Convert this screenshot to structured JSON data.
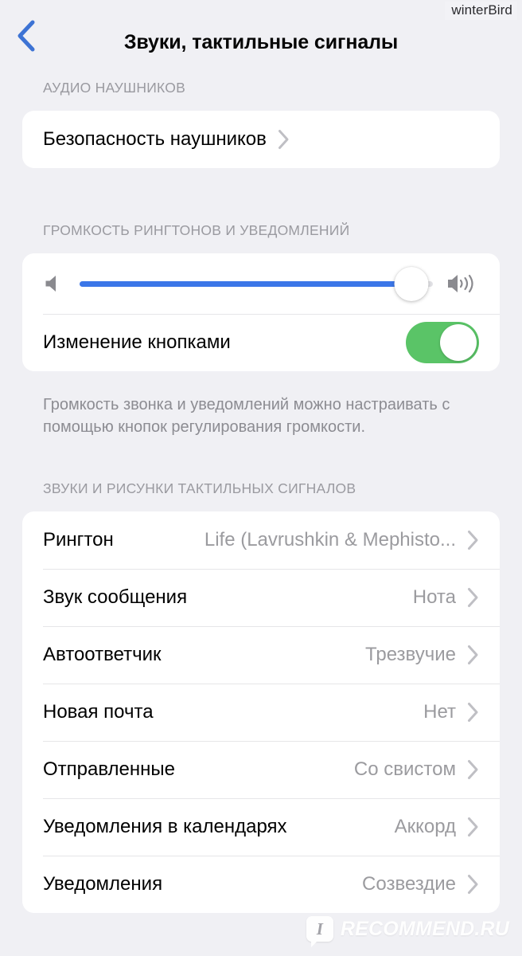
{
  "watermarks": {
    "top": "winterBird",
    "bottom_mark": "I",
    "bottom_text": "RECOMMEND.RU"
  },
  "navbar": {
    "back_icon": "chevron-left-icon",
    "title": "Звуки, тактильные сигналы",
    "accent_color": "#3d73d4"
  },
  "sections": {
    "headphone_audio": {
      "header": "АУДИО НАУШНИКОВ",
      "rows": [
        {
          "label": "Безопасность наушников",
          "value": "",
          "chevron": true
        }
      ]
    },
    "ringer_volume": {
      "header": "ГРОМКОСТЬ РИНГТОНОВ И УВЕДОМЛЕНИЙ",
      "slider": {
        "icon_left": "speaker-mute-icon",
        "icon_right": "speaker-wave-icon",
        "value_percent": 94,
        "fill_color": "#3b76e8",
        "track_color": "#e2e2e6"
      },
      "toggle_row": {
        "label": "Изменение кнопками",
        "state": "on",
        "on_color": "#5ac467"
      },
      "footer": "Громкость звонка и уведомлений можно настраивать с помощью кнопок регулирования громкости."
    },
    "sounds_haptics": {
      "header": "ЗВУКИ И РИСУНКИ ТАКТИЛЬНЫХ СИГНАЛОВ",
      "rows": [
        {
          "label": "Рингтон",
          "value": "Life (Lavrushkin & Mephisto...",
          "chevron": true
        },
        {
          "label": "Звук сообщения",
          "value": "Нота",
          "chevron": true
        },
        {
          "label": "Автоответчик",
          "value": "Трезвучие",
          "chevron": true
        },
        {
          "label": "Новая почта",
          "value": "Нет",
          "chevron": true
        },
        {
          "label": "Отправленные",
          "value": "Со свистом",
          "chevron": true
        },
        {
          "label": "Уведомления в календарях",
          "value": "Аккорд",
          "chevron": true
        },
        {
          "label": "Уведомления",
          "value": "Созвездие",
          "chevron": true
        }
      ]
    }
  }
}
